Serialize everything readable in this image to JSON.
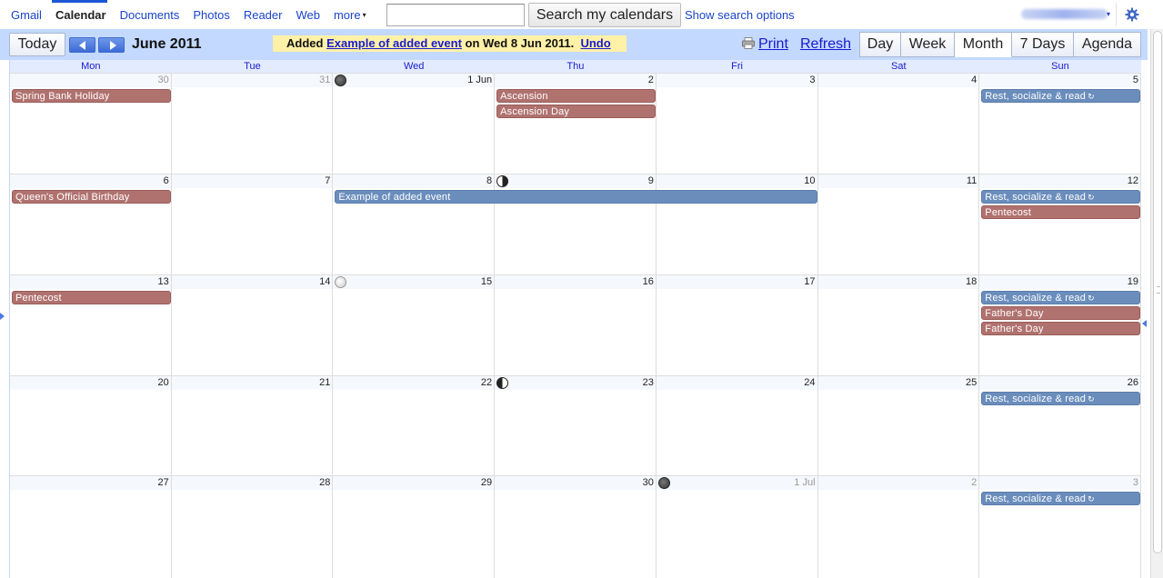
{
  "nav": {
    "links": [
      {
        "label": "Gmail",
        "name": "gmail"
      },
      {
        "label": "Calendar",
        "name": "calendar",
        "active": true
      },
      {
        "label": "Documents",
        "name": "documents"
      },
      {
        "label": "Photos",
        "name": "photos"
      },
      {
        "label": "Reader",
        "name": "reader"
      },
      {
        "label": "Web",
        "name": "web"
      },
      {
        "label": "more",
        "name": "more"
      }
    ],
    "more_caret": "▾"
  },
  "search": {
    "value": "",
    "button_label": "Search my calendars",
    "options_label": "Show search options"
  },
  "account": {
    "caret": "▾"
  },
  "toolbar": {
    "today_label": "Today",
    "date_range": "June 2011",
    "notice": {
      "prefix": "Added",
      "event_link": "Example of added event",
      "middle": "on Wed 8 Jun 2011.",
      "undo": "Undo"
    },
    "print_label": "Print",
    "refresh_label": "Refresh",
    "views": [
      {
        "label": "Day",
        "selected": false
      },
      {
        "label": "Week",
        "selected": false
      },
      {
        "label": "Month",
        "selected": true
      },
      {
        "label": "7 Days",
        "selected": false
      },
      {
        "label": "Agenda",
        "selected": false
      }
    ]
  },
  "calendar": {
    "day_headers": [
      "Mon",
      "Tue",
      "Wed",
      "Thu",
      "Fri",
      "Sat",
      "Sun"
    ],
    "colors": {
      "red": "#b0726f",
      "blue": "#6a8dbc"
    },
    "weeks": [
      {
        "days": [
          {
            "label": "30",
            "other": true
          },
          {
            "label": "31",
            "other": true
          },
          {
            "label": "1 Jun",
            "moon": "new"
          },
          {
            "label": "2"
          },
          {
            "label": "3"
          },
          {
            "label": "4"
          },
          {
            "label": "5"
          }
        ],
        "events": [
          {
            "title": "Spring Bank Holiday",
            "start": 0,
            "span": 1,
            "row": 0,
            "color": "red"
          },
          {
            "title": "Ascension",
            "start": 3,
            "span": 1,
            "row": 0,
            "color": "red"
          },
          {
            "title": "Ascension Day",
            "start": 3,
            "span": 1,
            "row": 1,
            "color": "red"
          },
          {
            "title": "Rest, socialize & read",
            "start": 6,
            "span": 1,
            "row": 0,
            "color": "blue",
            "repeat": true
          }
        ]
      },
      {
        "days": [
          {
            "label": "6"
          },
          {
            "label": "7"
          },
          {
            "label": "8"
          },
          {
            "label": "9",
            "moon": "first"
          },
          {
            "label": "10"
          },
          {
            "label": "11"
          },
          {
            "label": "12"
          }
        ],
        "events": [
          {
            "title": "Queen's Official Birthday",
            "start": 0,
            "span": 1,
            "row": 0,
            "color": "red"
          },
          {
            "title": "Example of added event",
            "start": 2,
            "span": 3,
            "row": 0,
            "color": "blue"
          },
          {
            "title": "Rest, socialize & read",
            "start": 6,
            "span": 1,
            "row": 0,
            "color": "blue",
            "repeat": true
          },
          {
            "title": "Pentecost",
            "start": 6,
            "span": 1,
            "row": 1,
            "color": "red"
          }
        ]
      },
      {
        "days": [
          {
            "label": "13"
          },
          {
            "label": "14"
          },
          {
            "label": "15",
            "moon": "full"
          },
          {
            "label": "16"
          },
          {
            "label": "17"
          },
          {
            "label": "18"
          },
          {
            "label": "19"
          }
        ],
        "events": [
          {
            "title": "Pentecost",
            "start": 0,
            "span": 1,
            "row": 0,
            "color": "red"
          },
          {
            "title": "Rest, socialize & read",
            "start": 6,
            "span": 1,
            "row": 0,
            "color": "blue",
            "repeat": true
          },
          {
            "title": "Father's Day",
            "start": 6,
            "span": 1,
            "row": 1,
            "color": "red"
          },
          {
            "title": "Father's Day",
            "start": 6,
            "span": 1,
            "row": 2,
            "color": "red"
          }
        ]
      },
      {
        "days": [
          {
            "label": "20"
          },
          {
            "label": "21"
          },
          {
            "label": "22"
          },
          {
            "label": "23",
            "moon": "last"
          },
          {
            "label": "24"
          },
          {
            "label": "25"
          },
          {
            "label": "26"
          }
        ],
        "events": [
          {
            "title": "Rest, socialize & read",
            "start": 6,
            "span": 1,
            "row": 0,
            "color": "blue",
            "repeat": true
          }
        ]
      },
      {
        "days": [
          {
            "label": "27"
          },
          {
            "label": "28"
          },
          {
            "label": "29"
          },
          {
            "label": "30"
          },
          {
            "label": "1 Jul",
            "other": true,
            "moon": "new"
          },
          {
            "label": "2",
            "other": true
          },
          {
            "label": "3",
            "other": true
          }
        ],
        "events": [
          {
            "title": "Rest, socialize & read",
            "start": 6,
            "span": 1,
            "row": 0,
            "color": "blue",
            "repeat": true
          }
        ]
      }
    ]
  }
}
